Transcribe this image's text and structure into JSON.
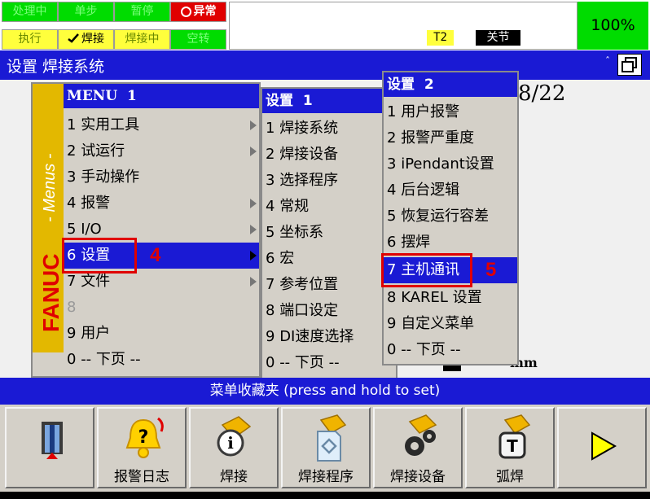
{
  "status": {
    "row1": [
      "处理中",
      "单步",
      "暂停",
      "异常"
    ],
    "row2": [
      "执行",
      "焊接",
      "焊接中",
      "空转"
    ],
    "tool_frame": "T2",
    "joint_mode": "关节",
    "speed_override": "100%"
  },
  "titlebar": {
    "title": "设置 焊接系统",
    "caret": "ˆ"
  },
  "background": {
    "page_counter": "8/22",
    "unit": "mm"
  },
  "fanuc_strip": {
    "menus_label": "- Menus -",
    "brand": "FANUC"
  },
  "menu1": {
    "header": "MENU  1",
    "items": [
      {
        "num": "1",
        "label": "实用工具"
      },
      {
        "num": "2",
        "label": "试运行"
      },
      {
        "num": "3",
        "label": "手动操作"
      },
      {
        "num": "4",
        "label": "报警"
      },
      {
        "num": "5",
        "label": "I/O"
      },
      {
        "num": "6",
        "label": "设置"
      },
      {
        "num": "7",
        "label": "文件"
      },
      {
        "num": "8",
        "label": ""
      },
      {
        "num": "9",
        "label": "用户"
      },
      {
        "num": "0",
        "label": "-- 下页 --"
      }
    ]
  },
  "menu2": {
    "header": "设置  1",
    "items": [
      {
        "num": "1",
        "label": "焊接系统"
      },
      {
        "num": "2",
        "label": "焊接设备"
      },
      {
        "num": "3",
        "label": "选择程序"
      },
      {
        "num": "4",
        "label": "常规"
      },
      {
        "num": "5",
        "label": "坐标系"
      },
      {
        "num": "6",
        "label": "宏"
      },
      {
        "num": "7",
        "label": "参考位置"
      },
      {
        "num": "8",
        "label": "端口设定"
      },
      {
        "num": "9",
        "label": "DI速度选择"
      },
      {
        "num": "0",
        "label": "-- 下页 --"
      }
    ]
  },
  "menu3": {
    "header": "设置  2",
    "items": [
      {
        "num": "1",
        "label": "用户报警"
      },
      {
        "num": "2",
        "label": "报警严重度"
      },
      {
        "num": "3",
        "label": "iPendant设置"
      },
      {
        "num": "4",
        "label": "后台逻辑"
      },
      {
        "num": "5",
        "label": "恢复运行容差"
      },
      {
        "num": "6",
        "label": "摆焊"
      },
      {
        "num": "7",
        "label": "主机通讯"
      },
      {
        "num": "8",
        "label": "KAREL 设置"
      },
      {
        "num": "9",
        "label": "自定义菜单"
      },
      {
        "num": "0",
        "label": "-- 下页 --"
      }
    ]
  },
  "annotations": {
    "step4": "4",
    "step5": "5"
  },
  "favorites_bar": "菜单收藏夹 (press and hold to set)",
  "function_keys": [
    {
      "label": "",
      "icon": "door-exit-icon"
    },
    {
      "label": "报警日志",
      "icon": "alarm-log-icon"
    },
    {
      "label": "焊接",
      "icon": "weld-torch-info-icon"
    },
    {
      "label": "焊接程序",
      "icon": "weld-program-icon"
    },
    {
      "label": "焊接设备",
      "icon": "weld-equipment-icon"
    },
    {
      "label": "弧焊",
      "icon": "arc-weld-icon"
    },
    {
      "label": "",
      "icon": "next-arrow-icon"
    }
  ]
}
